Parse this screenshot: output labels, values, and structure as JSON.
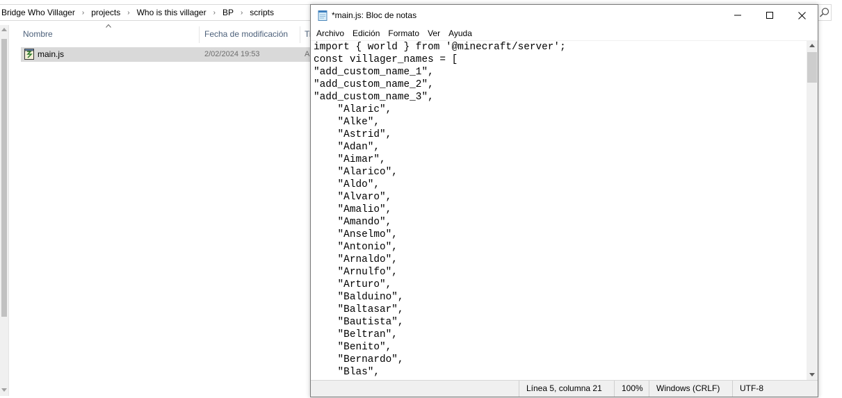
{
  "explorer": {
    "breadcrumbs": [
      "Bridge Who Villager",
      "projects",
      "Who is this villager",
      "BP",
      "scripts"
    ],
    "breadcrumb_separator": "›",
    "columns": {
      "name": "Nombre",
      "modified": "Fecha de modificación",
      "type": "Ti"
    },
    "file": {
      "name": "main.js",
      "modified": "2/02/2024 19:53",
      "type": "A"
    }
  },
  "notepad": {
    "title": "*main.js: Bloc de notas",
    "menu": [
      "Archivo",
      "Edición",
      "Formato",
      "Ver",
      "Ayuda"
    ],
    "content_lines": [
      "import { world } from '@minecraft/server';",
      "const villager_names = [",
      "\"add_custom_name_1\",",
      "\"add_custom_name_2\",",
      "\"add_custom_name_3\",",
      "    \"Alaric\",",
      "    \"Alke\",",
      "    \"Astrid\",",
      "    \"Adan\",",
      "    \"Aimar\",",
      "    \"Alarico\",",
      "    \"Aldo\",",
      "    \"Alvaro\",",
      "    \"Amalio\",",
      "    \"Amando\",",
      "    \"Anselmo\",",
      "    \"Antonio\",",
      "    \"Arnaldo\",",
      "    \"Arnulfo\",",
      "    \"Arturo\",",
      "    \"Balduino\",",
      "    \"Baltasar\",",
      "    \"Bautista\",",
      "    \"Beltran\",",
      "    \"Benito\",",
      "    \"Bernardo\",",
      "    \"Blas\","
    ],
    "status": {
      "position": "Línea 5, columna 21",
      "zoom": "100%",
      "line_endings": "Windows (CRLF)",
      "encoding": "UTF-8"
    }
  }
}
